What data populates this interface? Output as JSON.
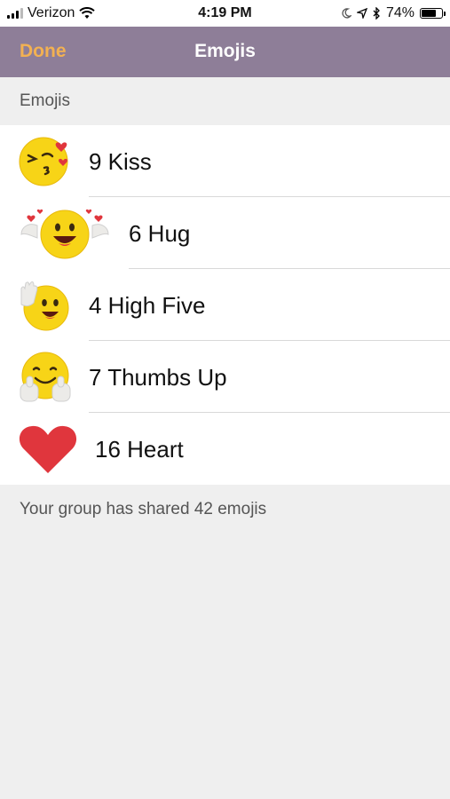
{
  "status_bar": {
    "carrier": "Verizon",
    "time": "4:19 PM",
    "battery": "74%"
  },
  "nav": {
    "done_label": "Done",
    "title": "Emojis"
  },
  "section_header": "Emojis",
  "emoji_list": [
    {
      "label": "9 Kiss",
      "icon": "kiss-emoji-icon"
    },
    {
      "label": "6 Hug",
      "icon": "hug-emoji-icon"
    },
    {
      "label": "4 High Five",
      "icon": "high-five-emoji-icon"
    },
    {
      "label": "7 Thumbs Up",
      "icon": "thumbs-up-emoji-icon"
    },
    {
      "label": "16 Heart",
      "icon": "heart-icon"
    }
  ],
  "footer": "Your group has shared 42 emojis",
  "colors": {
    "nav_background": "#8e7e98",
    "done_accent": "#f2b152",
    "emoji_yellow": "#f7d417",
    "heart_red": "#e0363d"
  }
}
